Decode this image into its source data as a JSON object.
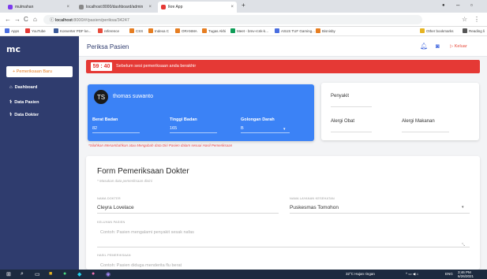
{
  "browser": {
    "tabs": [
      {
        "label": "mulmahan",
        "color": "#7c3aed"
      },
      {
        "label": "localhost:8000/dashboard/admin",
        "color": "#888888"
      },
      {
        "label": "Ikre App",
        "color": "#e53935"
      }
    ],
    "url_host": "localhost",
    "url_path": ":8000/#/pasien/periksa/34247",
    "bookmarks": [
      "Apps",
      "YouTube",
      "Konverter PDF ke...",
      "reference",
      "CSS",
      "Indexa C",
      "ORANMA",
      "Tugas Akhi",
      "Meet - bmv-rcnk-k...",
      "ASUS TUF Gaming...",
      "Bisnisby"
    ],
    "bookmarks_right": [
      "Other bookmarks",
      "Reading li"
    ]
  },
  "sidebar": {
    "logo": "mc",
    "new_button": "+ Pemeriksaan Baru",
    "items": [
      {
        "icon": "⌂",
        "label": "Dashboard"
      },
      {
        "icon": "⚕",
        "label": "Data Pasien"
      },
      {
        "icon": "⚕",
        "label": "Data Dokter"
      }
    ]
  },
  "header": {
    "title": "Periksa Pasien",
    "logout": "▷ Keluar"
  },
  "alert": {
    "timer": "59 : 40",
    "message": "Sebelum sesi pemeriksaan anda berakhir"
  },
  "patient": {
    "initials": "TS",
    "name": "thomas suwanto",
    "weight_label": "Berat Badan",
    "weight": "82",
    "height_label": "Tinggi Badan",
    "height": "165",
    "blood_label": "Golongan Darah",
    "blood": "B",
    "note": "*Silahkan Menambahkan atau Mengubah data Diri Pasien dalam sesuai Hasil Pemeriksaan"
  },
  "info": {
    "disease_label": "Penyakit",
    "drug_allergy_label": "Alergi Obat",
    "food_allergy_label": "Alergi Makanan"
  },
  "form": {
    "title": "Form Pemeriksaan Dokter",
    "subtitle": "* Masukan data pemeriksaan disini",
    "doctor_label": "NAMA DOKTER",
    "doctor_value": "Cleyra Lovelace",
    "facility_label": "NAMA LAYANAN KESEHATAN",
    "facility_value": "Puskesmas Tomohon",
    "complaint_label": "KELUHAN PASIEN",
    "complaint_placeholder": "Contoh: Pasien mengalami penyakit sesak nafas",
    "diagnosis_label": "HASIL PEMERIKSAAN",
    "diagnosis_placeholder": "Contoh: Pasien diduga menderita flu berat"
  },
  "taskbar": {
    "weather": "32°C Hujan ringan",
    "lang": "ENG",
    "time": "3:46 PM",
    "date": "6/26/2021"
  }
}
